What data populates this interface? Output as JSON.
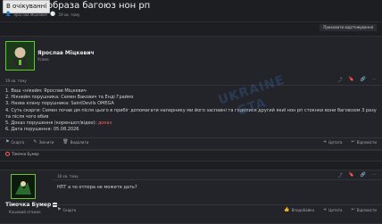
{
  "thread": {
    "badge": "В очікуванні",
    "title": "образа багоюз нон рп",
    "author": "Ярослав Міцкевич",
    "age": "19 хв. тому",
    "ignore_button": "Приховати відстежування"
  },
  "post1": {
    "author_name": "Ярослав Міцкевич",
    "author_role": "Усама",
    "date": "19 хв. тому",
    "lines": [
      "1. Ваш «нікейм: Ярослав Міцкевич",
      "2. Нікнейм порушника: Семен Вакович та Енді Граймз",
      "3. Назва клану порушника: SaintDevils OMEGA",
      "4. Суть скарги: Семен почав дм після цього в прибіг допомагати напарнику ми його заспавні та годилися другий якиї нон рп стокнки вони багоюзом 3 разу та після чого вбив",
      "5. Доказ порушення (кореншот/відео): ",
      "6. Дата порушення: 05.08.2026"
    ],
    "proof_link": "доказ",
    "actions": {
      "report": "Скарга",
      "edit": "Змінити",
      "delete": "Видалити",
      "quote": "Цитата",
      "reply": "Відповісти"
    }
  },
  "reply_strip": {
    "user": "Тімочка Бумер"
  },
  "post2": {
    "author_name": "Тімочка Бумер",
    "author_role": "Кошовий отаман",
    "date": "18 хв. тому",
    "text": "НПГ а чо отпора не можете дать?",
    "actions": {
      "report": "Скарга",
      "like": "Вподобайка",
      "quote": "Цитата",
      "reply": "Відповісти"
    }
  },
  "watermark": {
    "text1": "UKRAINE",
    "text2": "GTA"
  }
}
